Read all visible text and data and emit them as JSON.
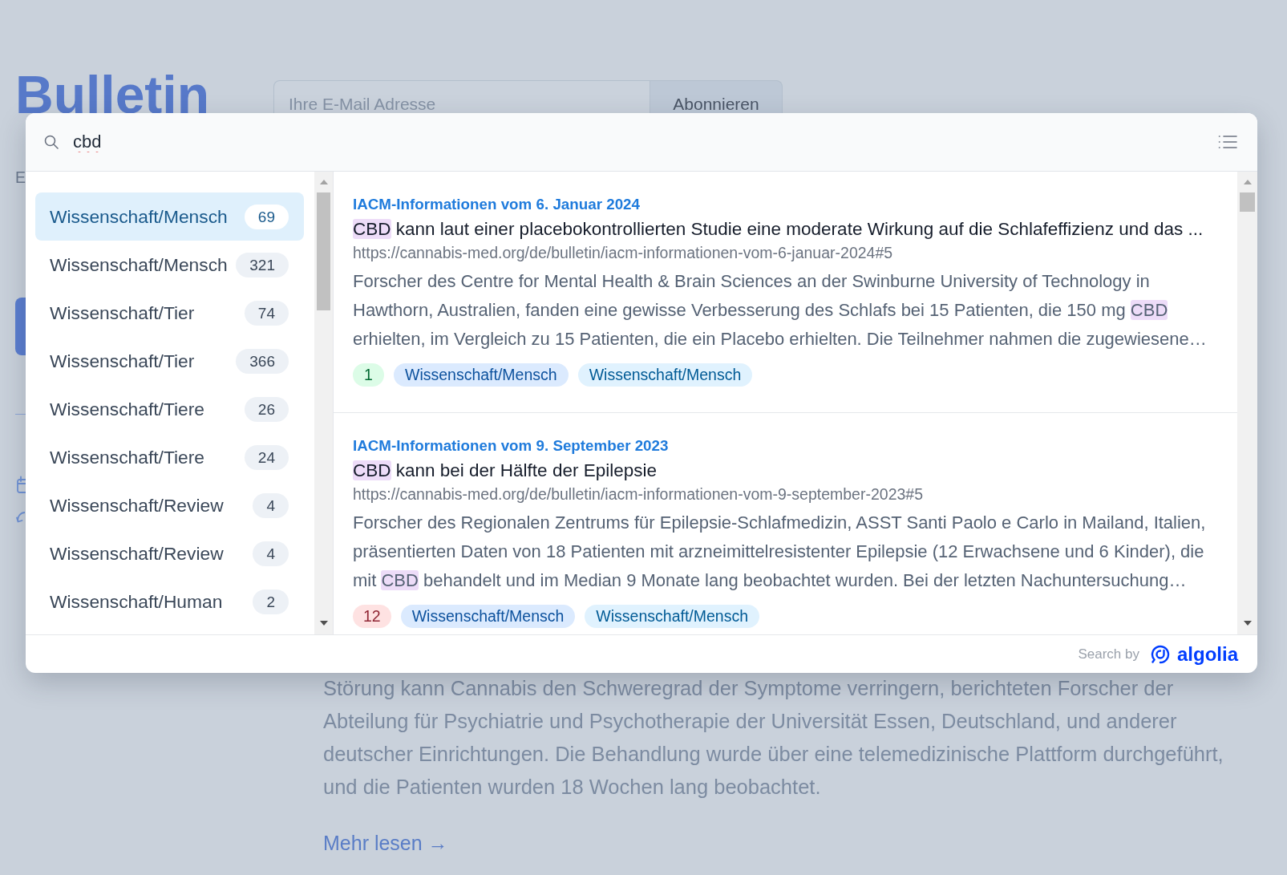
{
  "page": {
    "heading": "Bulletin",
    "email_field": {
      "placeholder": "Ihre E-Mail Adresse"
    },
    "subscribe_button": "Abonnieren",
    "text_fragment": "E",
    "paragraph": "Störung kann Cannabis den Schweregrad der Symptome verringern, berichteten Forscher der Abteilung für Psychiatrie und Psychotherapie der Universität Essen, Deutschland, und anderer deutscher Einrichtungen. Die Behandlung wurde über eine telemedizinische Plattform durchgeführt, und die Patienten wurden 18 Wochen lang beobachtet.",
    "more_link": "Mehr lesen →"
  },
  "search_dialog": {
    "query": "cbd",
    "facets": [
      {
        "label": "Wissenschaft/Mensch",
        "count": "69",
        "selected": true
      },
      {
        "label": "Wissenschaft/Mensch",
        "count": "321",
        "selected": false
      },
      {
        "label": "Wissenschaft/Tier",
        "count": "74",
        "selected": false
      },
      {
        "label": "Wissenschaft/Tier",
        "count": "366",
        "selected": false
      },
      {
        "label": "Wissenschaft/Tiere",
        "count": "26",
        "selected": false
      },
      {
        "label": "Wissenschaft/Tiere",
        "count": "24",
        "selected": false
      },
      {
        "label": "Wissenschaft/Review",
        "count": "4",
        "selected": false
      },
      {
        "label": "Wissenschaft/Review",
        "count": "4",
        "selected": false
      },
      {
        "label": "Wissenschaft/Human",
        "count": "2",
        "selected": false
      }
    ],
    "results": [
      {
        "source": "IACM-Informationen vom 6. Januar 2024",
        "title": [
          {
            "text": "CBD",
            "highlighted": true
          },
          {
            "text": " kann laut einer placebokontrollierten Studie eine moderate Wirkung auf die Schlafeffizienz und das ...",
            "highlighted": false
          }
        ],
        "url": "https://cannabis-med.org/de/bulletin/iacm-informationen-vom-6-januar-2024#5",
        "snippet": [
          {
            "text": "Forscher des Centre for Mental Health & Brain Sciences an der Swinburne University of Technology in Hawthorn, Australien, fanden eine gewisse Verbesserung des Schlafs bei 15 Patienten, die 150 mg ",
            "highlighted": false
          },
          {
            "text": "CBD",
            "highlighted": true
          },
          {
            "text": " erhielten, im Vergleich zu 15 Patienten, die ein Placebo erhielten. Die Teilnehmer nahmen die zugewiesene…",
            "highlighted": false
          }
        ],
        "tags": [
          {
            "kind": "count",
            "text": "1",
            "color": "#dcfce7"
          },
          {
            "kind": "category",
            "text": "Wissenschaft/Mensch",
            "color": "#dbeafe"
          },
          {
            "kind": "category",
            "text": "Wissenschaft/Mensch",
            "color": "#e0f2fe"
          }
        ]
      },
      {
        "source": "IACM-Informationen vom 9. September 2023",
        "title": [
          {
            "text": "CBD",
            "highlighted": true
          },
          {
            "text": " kann bei der Hälfte der Epilepsie",
            "highlighted": false
          }
        ],
        "url": "https://cannabis-med.org/de/bulletin/iacm-informationen-vom-9-september-2023#5",
        "snippet": [
          {
            "text": "Forscher des Regionalen Zentrums für Epilepsie-Schlafmedizin, ASST Santi Paolo e Carlo in Mailand, Italien, präsentierten Daten von 18 Patienten mit arzneimittelresistenter Epilepsie (12 Erwachsene und 6 Kinder), die mit ",
            "highlighted": false
          },
          {
            "text": "CBD",
            "highlighted": true
          },
          {
            "text": " behandelt und im Median 9 Monate lang beobachtet wurden. Bei der letzten Nachuntersuchung…",
            "highlighted": false
          }
        ],
        "tags": [
          {
            "kind": "count",
            "text": "12",
            "color": "#fee2e2"
          },
          {
            "kind": "category",
            "text": "Wissenschaft/Mensch",
            "color": "#dbeafe"
          },
          {
            "kind": "category",
            "text": "Wissenschaft/Mensch",
            "color": "#e0f2fe"
          }
        ]
      }
    ],
    "footer": {
      "label": "Search by",
      "logo_text": "algolia"
    }
  }
}
